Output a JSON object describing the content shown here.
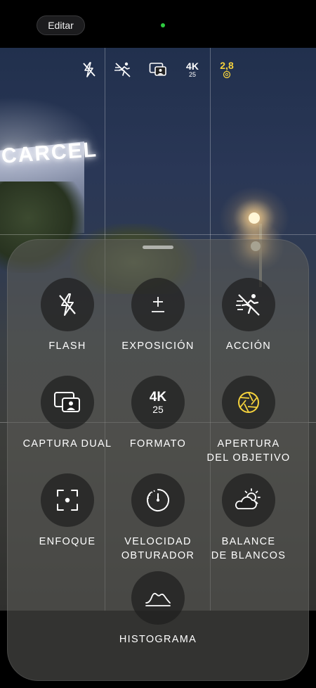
{
  "topbar": {
    "edit_label": "Editar"
  },
  "viewfinder": {
    "sign_text": "CARCEL"
  },
  "status_bar": {
    "format_resolution": "4K",
    "format_fps": "25",
    "aperture_value": "2,8"
  },
  "controls": [
    {
      "id": "flash",
      "label_lines": [
        "FLASH"
      ],
      "icon": "flash-off-icon"
    },
    {
      "id": "exposure",
      "label_lines": [
        "EXPOSICIÓN"
      ],
      "icon": "exposure-icon"
    },
    {
      "id": "action",
      "label_lines": [
        "ACCIÓN"
      ],
      "icon": "action-mode-off-icon"
    },
    {
      "id": "dual-capture",
      "label_lines": [
        "CAPTURA DUAL"
      ],
      "icon": "dual-capture-icon"
    },
    {
      "id": "format",
      "label_lines": [
        "FORMATO"
      ],
      "icon": "format-icon",
      "value_top": "4K",
      "value_bottom": "25"
    },
    {
      "id": "aperture",
      "label_lines": [
        "APERTURA",
        "DEL OBJETIVO"
      ],
      "icon": "aperture-icon"
    },
    {
      "id": "focus",
      "label_lines": [
        "ENFOQUE"
      ],
      "icon": "focus-icon"
    },
    {
      "id": "shutter",
      "label_lines": [
        "VELOCIDAD",
        "OBTURADOR"
      ],
      "icon": "shutter-speed-icon"
    },
    {
      "id": "white-balance",
      "label_lines": [
        "BALANCE",
        "DE BLANCOS"
      ],
      "icon": "white-balance-icon"
    },
    {
      "id": "histogram",
      "label_lines": [
        "HISTOGRAMA"
      ],
      "icon": "histogram-icon"
    }
  ],
  "colors": {
    "accent_yellow": "#f5d23c",
    "recording_indicator": "#2ecc40"
  }
}
